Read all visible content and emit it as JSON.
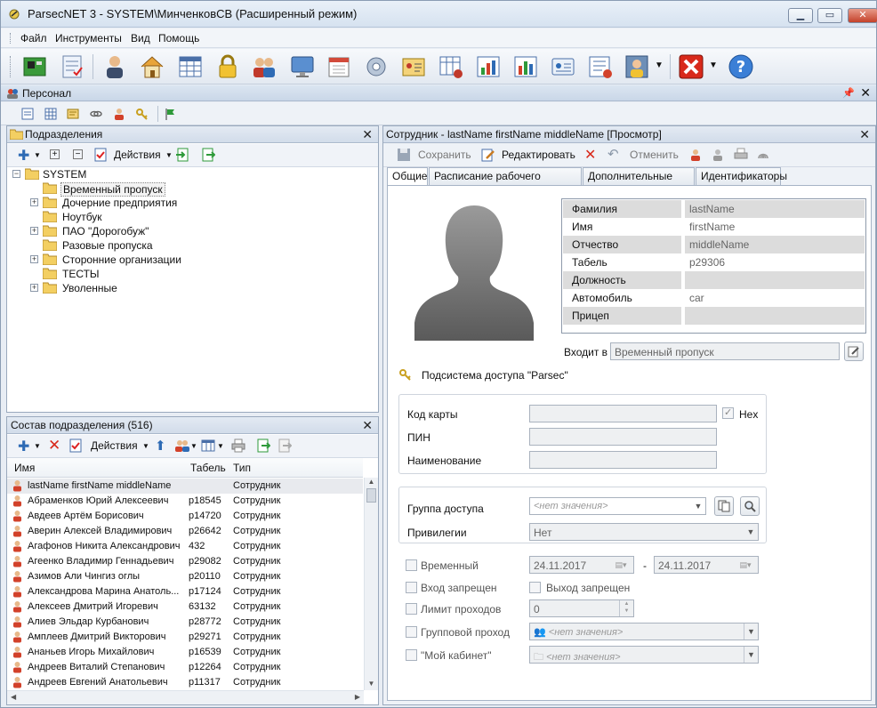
{
  "window": {
    "title": "ParsecNET 3 - SYSTEM\\МинченковСВ (Расширенный режим)"
  },
  "menu": [
    "Файл",
    "Инструменты",
    "Вид",
    "Помощь"
  ],
  "section": {
    "title": "Персонал"
  },
  "departments": {
    "title": "Подразделения",
    "actions_label": "Действия",
    "root": "SYSTEM",
    "items": [
      {
        "label": "Временный  пропуск",
        "expandable": false,
        "selected": true
      },
      {
        "label": "Дочерние предприятия",
        "expandable": true
      },
      {
        "label": "Ноутбук",
        "expandable": false
      },
      {
        "label": "ПАО \"Дорогобуж\"",
        "expandable": true
      },
      {
        "label": "Разовые пропуска",
        "expandable": false
      },
      {
        "label": "Сторонние организации",
        "expandable": true
      },
      {
        "label": "ТЕСТЫ",
        "expandable": false
      },
      {
        "label": "Уволенные",
        "expandable": true
      }
    ]
  },
  "composition": {
    "title": "Состав подразделения (516)",
    "actions_label": "Действия",
    "columns": [
      "Имя",
      "Табель",
      "Тип"
    ],
    "rows": [
      {
        "name": "lastName firstName middleName",
        "tab": "",
        "type": "Сотрудник",
        "selected": true
      },
      {
        "name": "Абраменков Юрий Алексеевич",
        "tab": "p18545",
        "type": "Сотрудник"
      },
      {
        "name": "Авдеев Артём Борисович",
        "tab": "p14720",
        "type": "Сотрудник"
      },
      {
        "name": "Аверин Алексей Владимирович",
        "tab": "p26642",
        "type": "Сотрудник"
      },
      {
        "name": "Агафонов Никита Александрович",
        "tab": "432",
        "type": "Сотрудник"
      },
      {
        "name": "Агеенко Владимир Геннадьевич",
        "tab": "p29082",
        "type": "Сотрудник"
      },
      {
        "name": "Азимов Али  Чингиз оглы",
        "tab": "p20110",
        "type": "Сотрудник"
      },
      {
        "name": "Александрова Марина Анатоль...",
        "tab": "p17124",
        "type": "Сотрудник"
      },
      {
        "name": "Алексеев Дмитрий Игоревич",
        "tab": "63132",
        "type": "Сотрудник"
      },
      {
        "name": "Алиев Эльдар Курбанович",
        "tab": "p28772",
        "type": "Сотрудник"
      },
      {
        "name": "Амплеев Дмитрий Викторович",
        "tab": "p29271",
        "type": "Сотрудник"
      },
      {
        "name": "Ананьев Игорь Михайлович",
        "tab": "p16539",
        "type": "Сотрудник"
      },
      {
        "name": "Андреев Виталий Степанович",
        "tab": "p12264",
        "type": "Сотрудник"
      },
      {
        "name": "Андреев Евгений Анатольевич",
        "tab": "p11317",
        "type": "Сотрудник"
      }
    ]
  },
  "employee": {
    "title": "Сотрудник - lastName firstName middleName [Просмотр]",
    "toolbar": {
      "save": "Сохранить",
      "edit": "Редактировать",
      "cancel": "Отменить"
    },
    "tabs": [
      "Общие",
      "Расписание рабочего времени",
      "Дополнительные поля",
      "Идентификаторы"
    ],
    "info": [
      {
        "key": "Фамилия",
        "value": "lastName"
      },
      {
        "key": "Имя",
        "value": "firstName"
      },
      {
        "key": "Отчество",
        "value": "middleName"
      },
      {
        "key": "Табель",
        "value": "p29306"
      },
      {
        "key": "Должность",
        "value": ""
      },
      {
        "key": "Автомобиль",
        "value": "car"
      },
      {
        "key": "Прицеп",
        "value": ""
      }
    ],
    "belongs_label": "Входит в",
    "belongs_value": "Временный  пропуск",
    "subsystem": "Подсистема доступа \"Parsec\"",
    "card_label": "Код карты",
    "hex_label": "Hex",
    "pin_label": "ПИН",
    "name_label": "Наименование",
    "group_label": "Группа доступа",
    "group_value": "<нет значения>",
    "priv_label": "Привилегии",
    "priv_value": "Нет",
    "temp_label": "Временный",
    "date_from": "24.11.2017",
    "date_to": "24.11.2017",
    "date_sep": "-",
    "entry_label": "Вход запрещен",
    "exit_label": "Выход запрещен",
    "limit_label": "Лимит проходов",
    "limit_value": "0",
    "group_pass_label": "Групповой проход",
    "group_pass_value": "<нет значения>",
    "cabinet_label": "\"Мой кабинет\"",
    "cabinet_value": "<нет значения>"
  }
}
